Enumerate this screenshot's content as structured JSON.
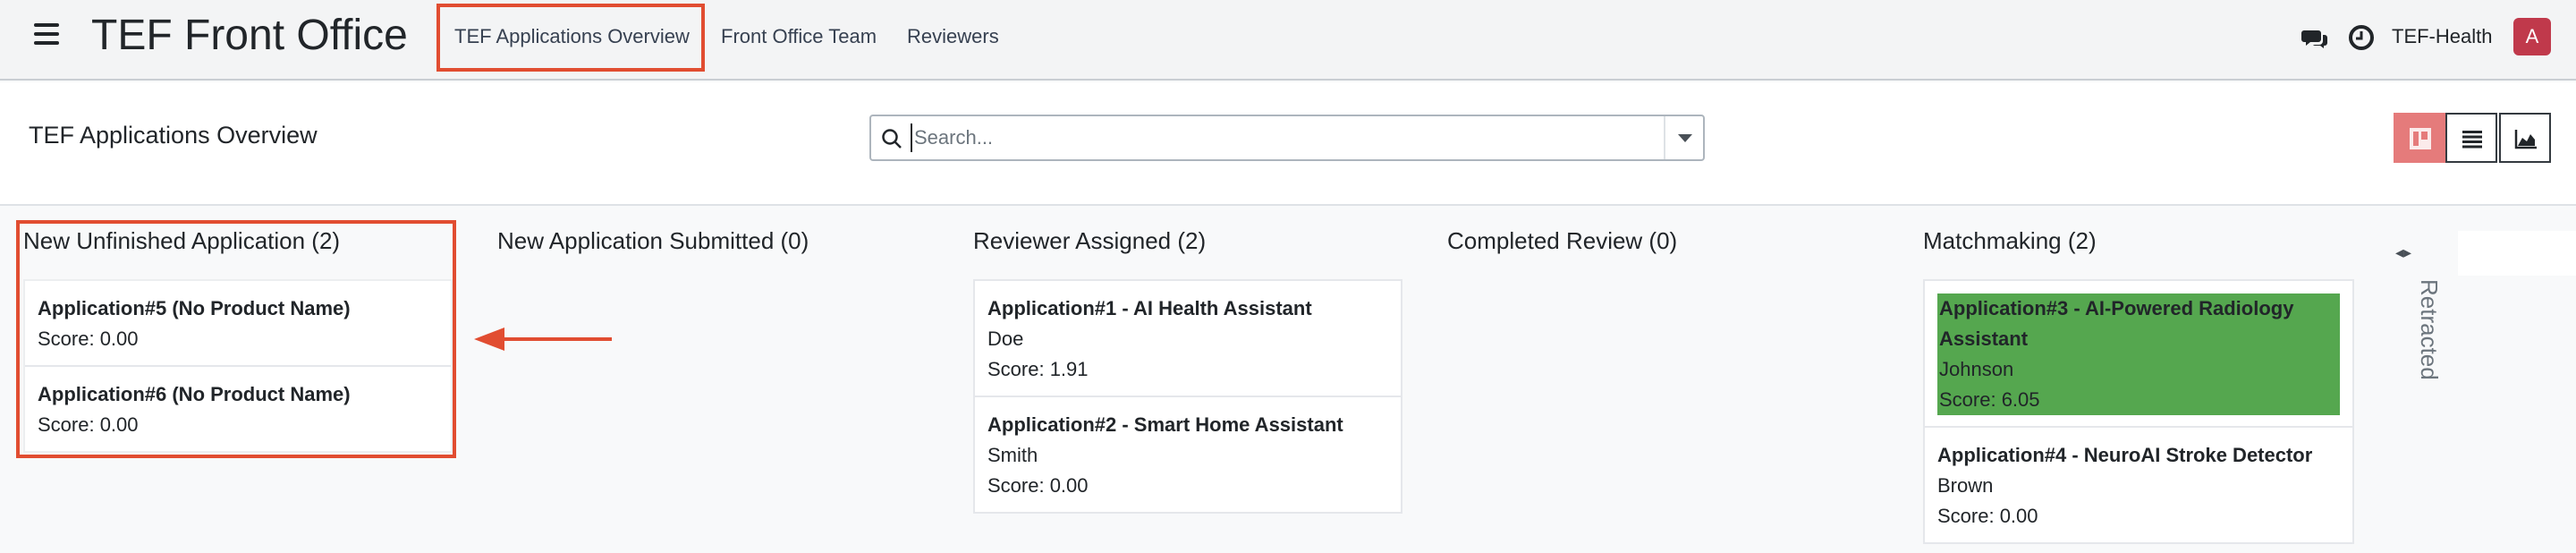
{
  "app": {
    "title": "TEF Front Office"
  },
  "nav": {
    "items": [
      {
        "label": "TEF Applications Overview"
      },
      {
        "label": "Front Office Team"
      },
      {
        "label": "Reviewers"
      }
    ],
    "company": "TEF-Health",
    "avatar_letter": "A",
    "icons": [
      "chat-icon",
      "clock-icon"
    ]
  },
  "control_panel": {
    "title": "TEF Applications Overview",
    "search": {
      "placeholder": "Search...",
      "value": ""
    },
    "views": [
      "kanban-view",
      "list-view",
      "graph-view"
    ],
    "active_view": "kanban-view"
  },
  "kanban": {
    "columns": [
      {
        "header": "New Unfinished Application (2)",
        "cards": [
          {
            "title": "Application#5 (No Product Name)",
            "lines": [
              "Score: 0.00"
            ]
          },
          {
            "title": "Application#6 (No Product Name)",
            "lines": [
              "Score: 0.00"
            ]
          }
        ]
      },
      {
        "header": "New Application Submitted (0)",
        "cards": []
      },
      {
        "header": "Reviewer Assigned (2)",
        "cards": [
          {
            "title": "Application#1 - AI Health Assistant",
            "lines": [
              "Doe",
              "Score: 1.91"
            ]
          },
          {
            "title": "Application#2 - Smart Home Assistant",
            "lines": [
              "Smith",
              "Score: 0.00"
            ]
          }
        ]
      },
      {
        "header": "Completed Review (0)",
        "cards": []
      },
      {
        "header": "Matchmaking (2)",
        "cards": [
          {
            "title": "Application#3 - AI-Powered Radiology Assistant",
            "lines": [
              "Johnson",
              "Score: 6.05"
            ],
            "highlight": true
          },
          {
            "title": "Application#4 - NeuroAI Stroke Detector",
            "lines": [
              "Brown",
              "Score: 0.00"
            ]
          }
        ]
      }
    ],
    "retracted_label": "Retracted"
  },
  "colors": {
    "annotation": "#e14d31",
    "highlight_card": "#55a74f",
    "active_view": "#e57b7b",
    "avatar": "#c0394b"
  }
}
